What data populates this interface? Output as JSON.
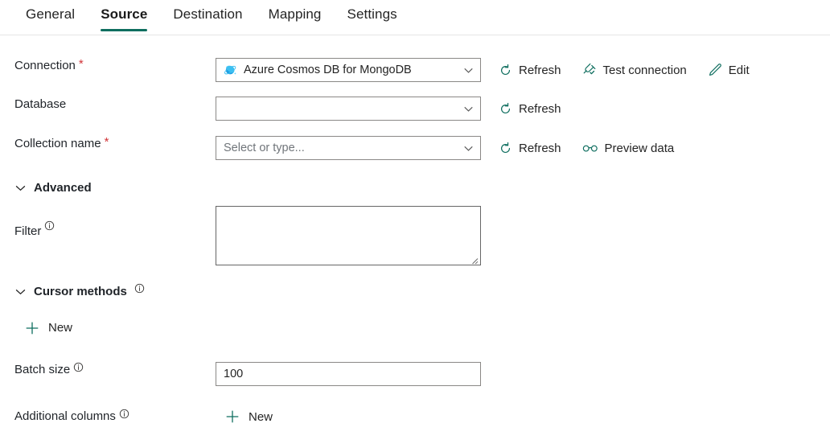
{
  "tabs": [
    {
      "label": "General",
      "active": false
    },
    {
      "label": "Source",
      "active": true
    },
    {
      "label": "Destination",
      "active": false
    },
    {
      "label": "Mapping",
      "active": false
    },
    {
      "label": "Settings",
      "active": false
    }
  ],
  "colors": {
    "accent_teal": "#0f6e5f",
    "required_red": "#d13438",
    "label_text": "#1f2328",
    "field_border": "#8a8886",
    "placeholder": "#70757a"
  },
  "fields": {
    "connection": {
      "label": "Connection",
      "required": true,
      "value": "Azure Cosmos DB for MongoDB",
      "icon": "azure-cosmos-db-icon",
      "actions": [
        {
          "label": "Refresh",
          "icon": "refresh-icon"
        },
        {
          "label": "Test connection",
          "icon": "plug-check-icon"
        },
        {
          "label": "Edit",
          "icon": "pencil-icon"
        }
      ]
    },
    "database": {
      "label": "Database",
      "required": false,
      "value": "",
      "placeholder": "",
      "actions": [
        {
          "label": "Refresh",
          "icon": "refresh-icon"
        }
      ]
    },
    "collection_name": {
      "label": "Collection name",
      "required": true,
      "value": "",
      "placeholder": "Select or type...",
      "actions": [
        {
          "label": "Refresh",
          "icon": "refresh-icon"
        },
        {
          "label": "Preview data",
          "icon": "glasses-icon"
        }
      ]
    },
    "filter": {
      "label": "Filter",
      "info": true,
      "value": ""
    },
    "batch_size": {
      "label": "Batch size",
      "info": true,
      "value": "100"
    },
    "additional_columns": {
      "label": "Additional columns",
      "info": true,
      "new_label": "New"
    }
  },
  "sections": {
    "advanced": {
      "label": "Advanced",
      "expanded": true,
      "info": false
    },
    "cursor_methods": {
      "label": "Cursor methods",
      "expanded": true,
      "info": true,
      "new_label": "New"
    }
  }
}
